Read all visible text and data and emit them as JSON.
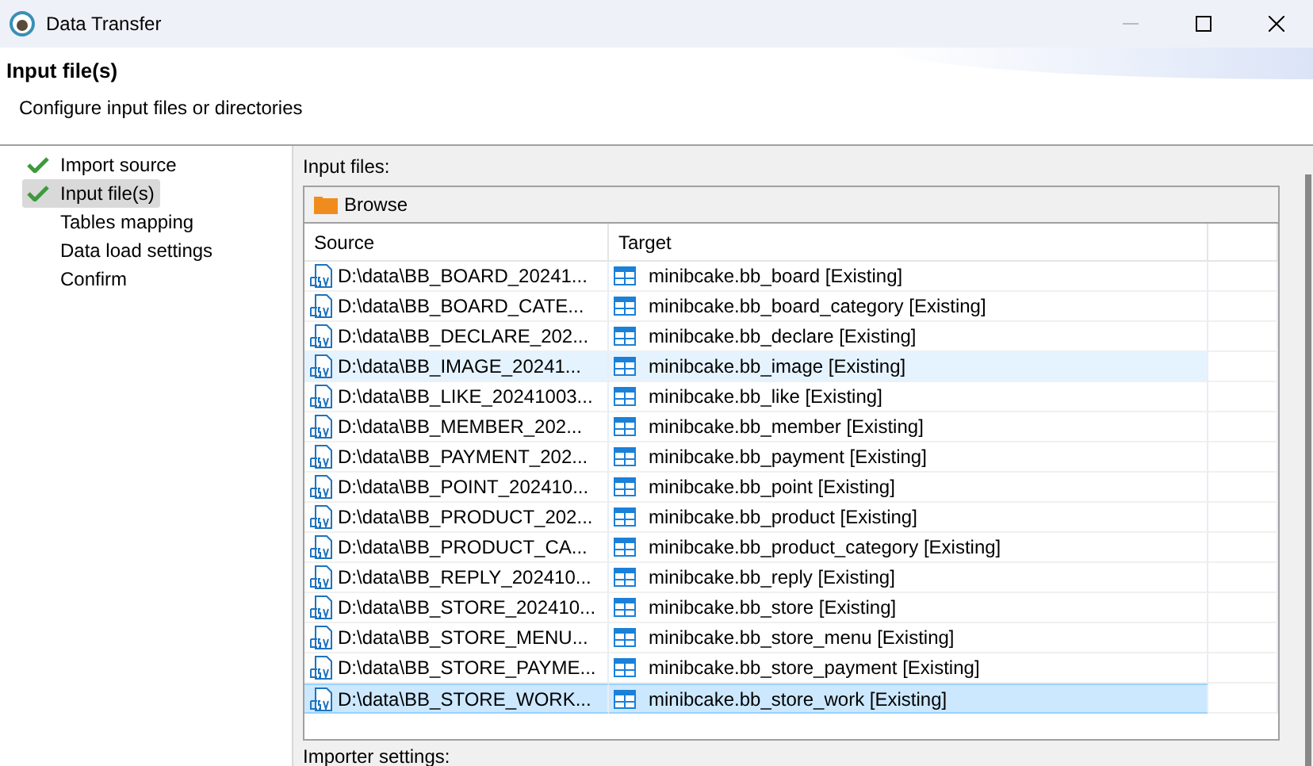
{
  "window": {
    "title": "Data Transfer"
  },
  "header": {
    "title": "Input file(s)",
    "subtitle": "Configure input files or directories"
  },
  "steps": [
    {
      "label": "Import source",
      "done": true,
      "selected": false
    },
    {
      "label": "Input file(s)",
      "done": true,
      "selected": true
    },
    {
      "label": "Tables mapping",
      "done": false,
      "selected": false
    },
    {
      "label": "Data load settings",
      "done": false,
      "selected": false
    },
    {
      "label": "Confirm",
      "done": false,
      "selected": false
    }
  ],
  "input_files": {
    "label": "Input files:",
    "toolbar": {
      "browse": "Browse"
    },
    "columns": [
      "Source",
      "Target"
    ],
    "rows": [
      {
        "source": "D:\\data\\BB_BOARD_20241...",
        "target": "minibcake.bb_board [Existing]",
        "hovered": false,
        "selected": false
      },
      {
        "source": "D:\\data\\BB_BOARD_CATE...",
        "target": "minibcake.bb_board_category [Existing]",
        "hovered": false,
        "selected": false
      },
      {
        "source": "D:\\data\\BB_DECLARE_202...",
        "target": "minibcake.bb_declare [Existing]",
        "hovered": false,
        "selected": false
      },
      {
        "source": "D:\\data\\BB_IMAGE_20241...",
        "target": "minibcake.bb_image [Existing]",
        "hovered": true,
        "selected": false
      },
      {
        "source": "D:\\data\\BB_LIKE_20241003...",
        "target": "minibcake.bb_like [Existing]",
        "hovered": false,
        "selected": false
      },
      {
        "source": "D:\\data\\BB_MEMBER_202...",
        "target": "minibcake.bb_member [Existing]",
        "hovered": false,
        "selected": false
      },
      {
        "source": "D:\\data\\BB_PAYMENT_202...",
        "target": "minibcake.bb_payment [Existing]",
        "hovered": false,
        "selected": false
      },
      {
        "source": "D:\\data\\BB_POINT_202410...",
        "target": "minibcake.bb_point [Existing]",
        "hovered": false,
        "selected": false
      },
      {
        "source": "D:\\data\\BB_PRODUCT_202...",
        "target": "minibcake.bb_product [Existing]",
        "hovered": false,
        "selected": false
      },
      {
        "source": "D:\\data\\BB_PRODUCT_CA...",
        "target": "minibcake.bb_product_category [Existing]",
        "hovered": false,
        "selected": false
      },
      {
        "source": "D:\\data\\BB_REPLY_202410...",
        "target": "minibcake.bb_reply [Existing]",
        "hovered": false,
        "selected": false
      },
      {
        "source": "D:\\data\\BB_STORE_202410...",
        "target": "minibcake.bb_store [Existing]",
        "hovered": false,
        "selected": false
      },
      {
        "source": "D:\\data\\BB_STORE_MENU...",
        "target": "minibcake.bb_store_menu [Existing]",
        "hovered": false,
        "selected": false
      },
      {
        "source": "D:\\data\\BB_STORE_PAYME...",
        "target": "minibcake.bb_store_payment [Existing]",
        "hovered": false,
        "selected": false
      },
      {
        "source": "D:\\data\\BB_STORE_WORK...",
        "target": "minibcake.bb_store_work [Existing]",
        "hovered": false,
        "selected": true
      }
    ]
  },
  "importer_settings": {
    "label": "Importer settings:"
  }
}
